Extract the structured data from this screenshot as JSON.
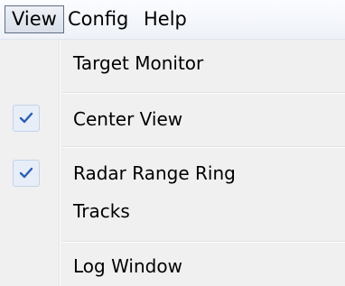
{
  "menubar": {
    "items": [
      {
        "label": "View",
        "open": true
      },
      {
        "label": "Config",
        "open": false
      },
      {
        "label": "Help",
        "open": false
      }
    ]
  },
  "view_menu": {
    "items": [
      {
        "label": "Target Monitor",
        "checked": false
      },
      {
        "label": "Center View",
        "checked": true
      },
      {
        "label": "Radar Range Ring",
        "checked": true
      },
      {
        "label": "Tracks",
        "checked": false
      },
      {
        "label": "Log Window",
        "checked": false
      }
    ]
  },
  "colors": {
    "check_mark": "#2c5fb4",
    "check_background": "#e7eef7",
    "menu_background": "#f0f0f0"
  },
  "icons": {
    "check": "check-icon"
  }
}
